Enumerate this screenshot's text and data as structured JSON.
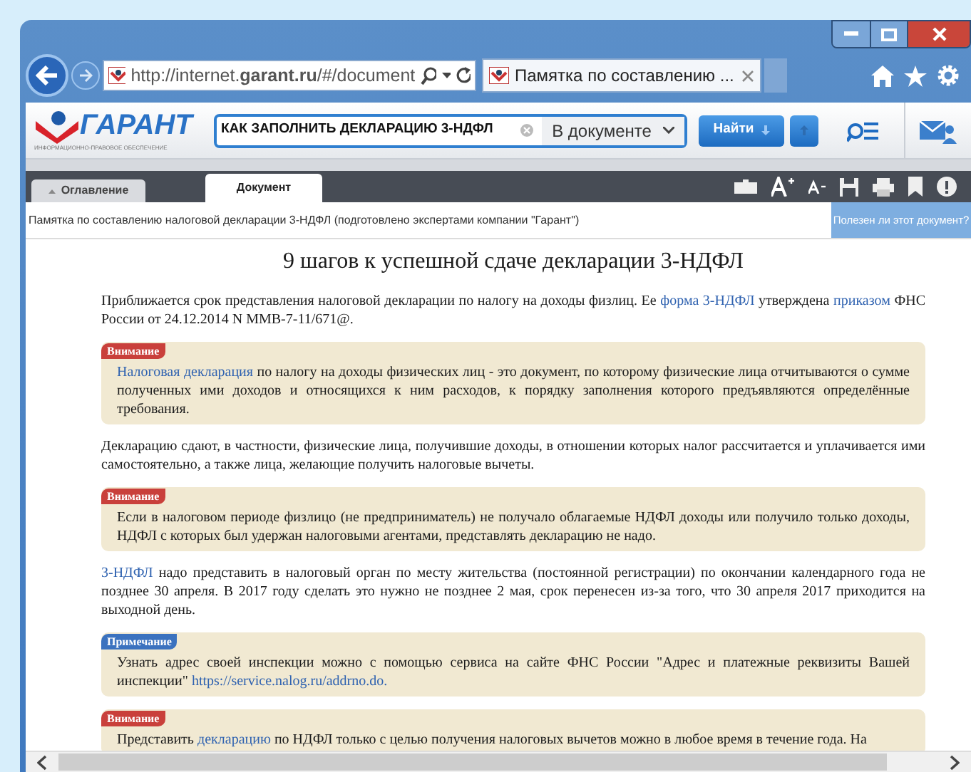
{
  "browser": {
    "url": "http://internet.**garant.ru**/#/document",
    "tab_title": "Памятка по составлению ..."
  },
  "toolbar": {
    "logo": "ГАРАНТ",
    "logo_subtitle": "ИНФОРМАЦИОННО-ПРАВОВОЕ ОБЕСПЕЧЕНИЕ",
    "search_value": "КАК ЗАПОЛНИТЬ ДЕКЛАРАЦИЮ 3-НДФЛ",
    "scope": "В документе",
    "find_button": "Найти"
  },
  "doc_tabs": [
    {
      "label": "Оглавление",
      "selected": false
    },
    {
      "label": "Документ",
      "selected": true
    }
  ],
  "breadcrumb": "Памятка по составлению налоговой декларации 3-НДФЛ (подготовлено экспертами компании \"Гарант\")",
  "feedback": "Полезен ли этот документ?",
  "title": "9 шагов к успешной сдаче декларации 3-НДФЛ",
  "blocks": [
    {
      "kind": "paragraph",
      "segments": [
        {
          "text": "Приближается срок представления налоговой декларации по налогу на доходы физлиц. Ее ",
          "link": false
        },
        {
          "text": "форма 3-НДФЛ",
          "link": true
        },
        {
          "text": " утверждена ",
          "link": false
        },
        {
          "text": "приказом",
          "link": true
        },
        {
          "text": " ФНС России от 24.12.2014 N ММВ-7-11/671@.",
          "link": false
        }
      ]
    },
    {
      "kind": "note",
      "label": "Внимание",
      "color": "#c9403b",
      "segments": [
        {
          "text": "Налоговая декларация",
          "link": true
        },
        {
          "text": " по налогу на доходы физических лиц - это документ, по которому физические лица отчитываются о сумме полученных ими доходов и относящихся к ним расходов, к порядку заполнения которого предъявляются определённые требования.",
          "link": false
        }
      ]
    },
    {
      "kind": "paragraph",
      "segments": [
        {
          "text": "Декларацию сдают, в частности, физические лица, получившие доходы, в отношении которых налог рассчитается и уплачивается ими самостоятельно, а также лица, желающие получить налоговые вычеты.",
          "link": false
        }
      ]
    },
    {
      "kind": "note",
      "label": "Внимание",
      "color": "#c9403b",
      "segments": [
        {
          "text": "Если в налоговом периоде физлицо (не предприниматель) не получало облагаемые НДФЛ доходы или получило только доходы, НДФЛ с которых был удержан налоговыми агентами, представлять декларацию не надо.",
          "link": false
        }
      ]
    },
    {
      "kind": "paragraph",
      "segments": [
        {
          "text": "3-НДФЛ",
          "link": true
        },
        {
          "text": " надо представить в налоговый орган по месту жительства (постоянной регистрации) по окончании календарного года не позднее 30 апреля. В 2017 году сделать это нужно не позднее 2 мая, срок перенесен из-за того, что 30 апреля 2017 приходится на выходной день.",
          "link": false
        }
      ]
    },
    {
      "kind": "note",
      "label": "Примечание",
      "color": "#3b72bf",
      "segments": [
        {
          "text": "Узнать адрес своей инспекции можно с помощью сервиса на сайте ФНС России \"Адрес и платежные реквизиты Вашей инспекции\" ",
          "link": false
        },
        {
          "text": "https://service.nalog.ru/addrno.do.",
          "link": true
        }
      ]
    },
    {
      "kind": "note",
      "label": "Внимание",
      "color": "#c9403b",
      "segments": [
        {
          "text": "Представить ",
          "link": false
        },
        {
          "text": "декларацию",
          "link": true
        },
        {
          "text": " по НДФЛ только с целью получения налоговых вычетов можно в любое время в течение года. На",
          "link": false
        }
      ]
    }
  ]
}
